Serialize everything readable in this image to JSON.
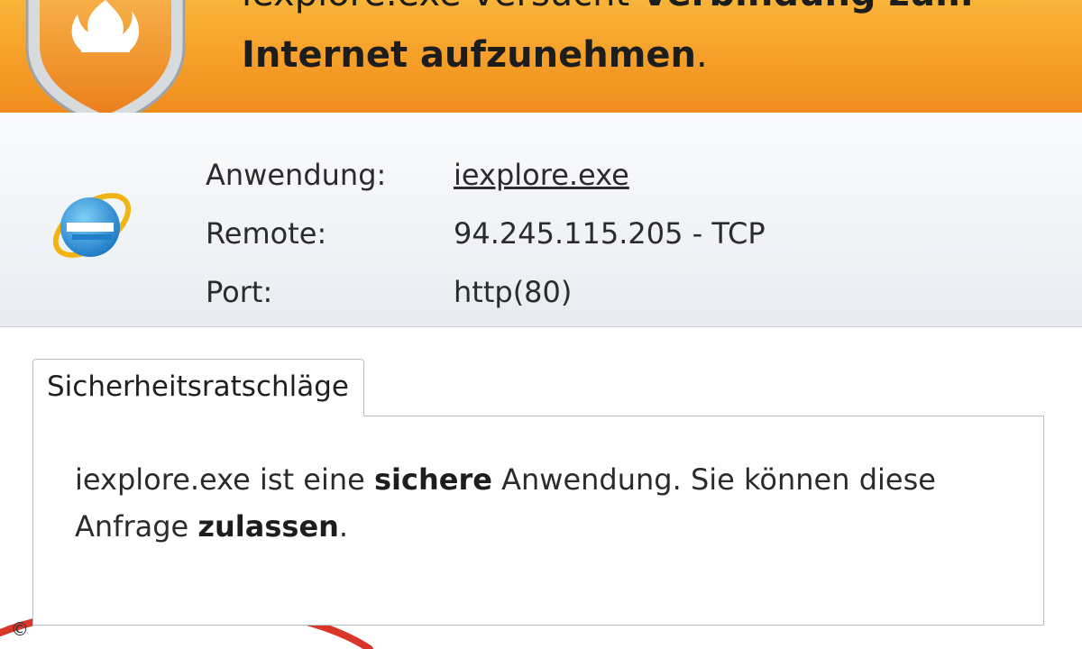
{
  "header": {
    "line1_prefix": "iexplore.exe versucht ",
    "line1_bold": "Verbindung zum",
    "line2_bold": "Internet aufzunehmen",
    "line2_suffix": "."
  },
  "icons": {
    "shield": "firewall-shield-icon",
    "app": "internet-explorer-icon"
  },
  "info": {
    "application_label": "Anwendung:",
    "application_value": "iexplore.exe",
    "remote_label": "Remote:",
    "remote_value": "94.245.115.205 - TCP",
    "port_label": "Port:",
    "port_value": "http(80)"
  },
  "tab": {
    "label": "Sicherheitsratschläge"
  },
  "advice": {
    "t1": "iexplore.exe ist eine ",
    "b1": "sichere",
    "t2": " Anwendung. Sie können diese Anfrage ",
    "b2": "zulassen",
    "t3": "."
  },
  "copyright": "©",
  "colors": {
    "header": "#f6a22a",
    "annotation": "#d9352b"
  }
}
